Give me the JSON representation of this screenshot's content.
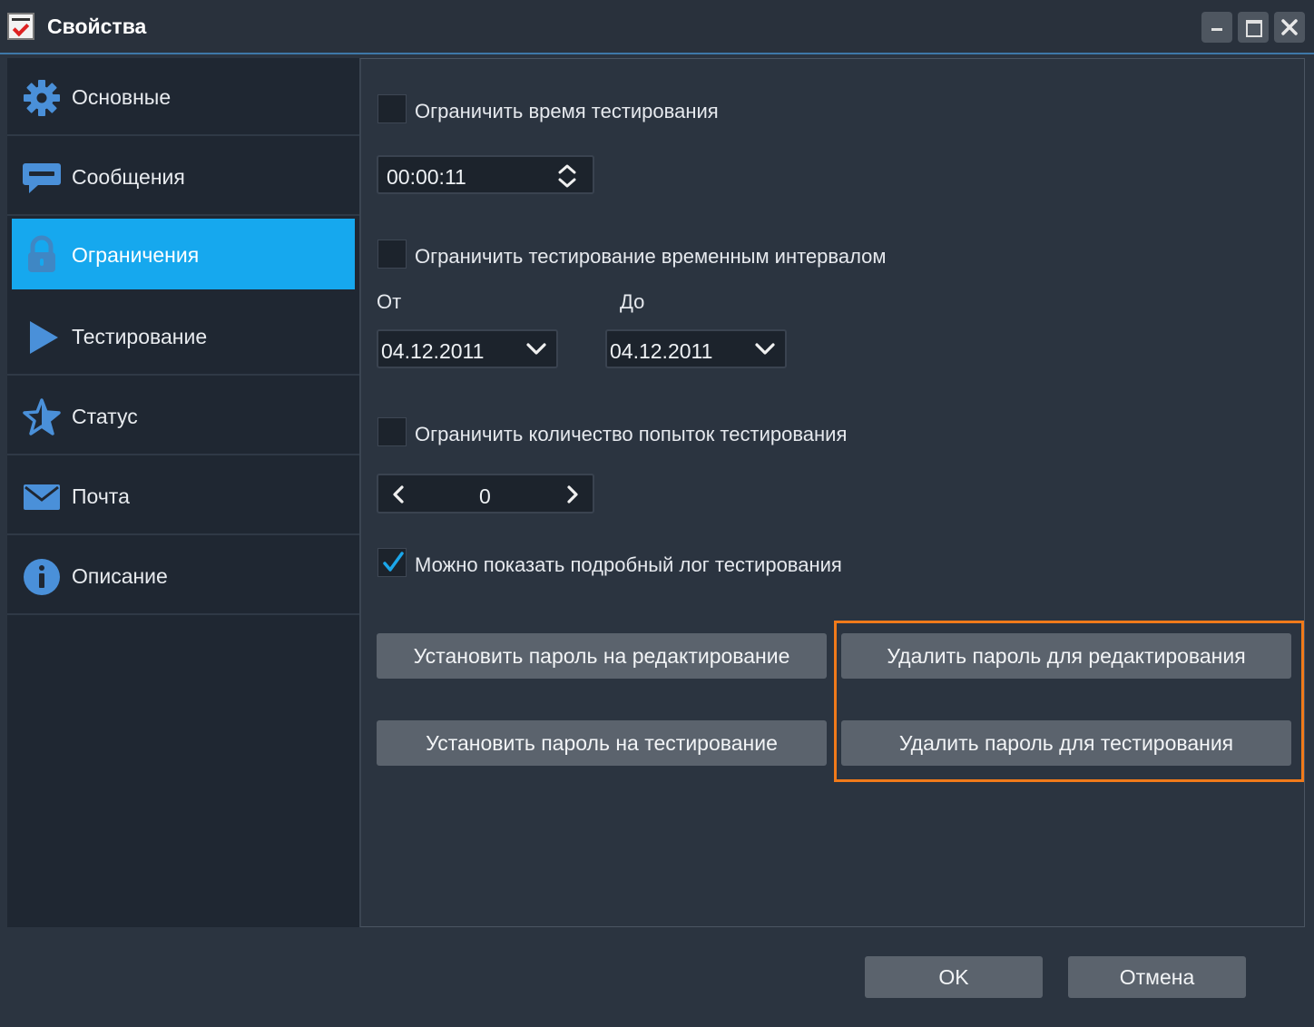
{
  "window": {
    "title": "Свойства",
    "app_icon": "app-logo-icon",
    "controls": [
      "minimize-icon",
      "maximize-icon",
      "close-icon"
    ]
  },
  "sidebar": {
    "items": [
      {
        "label": "Основные",
        "icon": "gear-icon"
      },
      {
        "label": "Сообщения",
        "icon": "message-icon"
      },
      {
        "label": "Ограничения",
        "icon": "lock-icon",
        "active": true
      },
      {
        "label": "Тестирование",
        "icon": "play-icon"
      },
      {
        "label": "Статус",
        "icon": "star-icon"
      },
      {
        "label": "Почта",
        "icon": "mail-icon"
      },
      {
        "label": "Описание",
        "icon": "info-icon"
      }
    ]
  },
  "limits": {
    "time": {
      "label": "Ограничить время тестирования",
      "checked": false,
      "value": "00:00:11"
    },
    "interval": {
      "label": "Ограничить тестирование временным интервалом",
      "checked": false,
      "from_label": "От",
      "to_label": "До",
      "from_value": "04.12.2011",
      "to_value": "04.12.2011"
    },
    "attempts": {
      "label": "Ограничить количество попыток тестирования",
      "checked": false,
      "value": "0"
    },
    "log": {
      "label": "Можно показать подробный лог тестирования",
      "checked": true
    }
  },
  "passwords": {
    "set_edit": "Установить пароль на редактирование",
    "delete_edit": "Удалить пароль для редактирования",
    "set_test": "Установить пароль на тестирование",
    "delete_test": "Удалить пароль для тестирования"
  },
  "footer": {
    "ok": "OK",
    "cancel": "Отмена"
  },
  "colors": {
    "accent": "#16a8ee",
    "highlight": "#f07a1a",
    "icon": "#4a90d9"
  }
}
